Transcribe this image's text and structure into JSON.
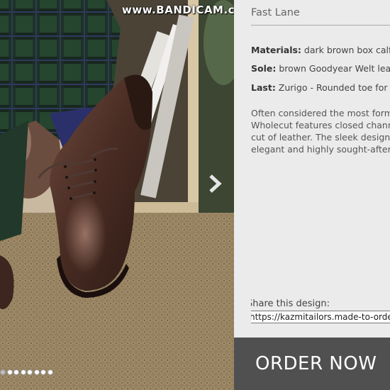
{
  "watermark": "www.BANDICAM.com",
  "product": {
    "name": "Fast Lane",
    "specs": [
      {
        "label": "Materials:",
        "value": " dark brown box calf"
      },
      {
        "label": "Sole:",
        "value": " brown Goodyear Welt leat"
      },
      {
        "label": "Last:",
        "value": " Zurigo - Rounded toe for tr"
      }
    ],
    "description": [
      "Often considered the most form",
      "Wholecut features closed chann",
      "cut of leather. The sleek design a",
      "elegant and highly sought-after s"
    ]
  },
  "share": {
    "label": "Share this design:",
    "url": "https://kazmitailors.made-to-order.co"
  },
  "order_button": "ORDER NOW",
  "carousel": {
    "dot_count": 8,
    "active_index": 0
  },
  "icons": {
    "next": "chevron-right-icon"
  }
}
